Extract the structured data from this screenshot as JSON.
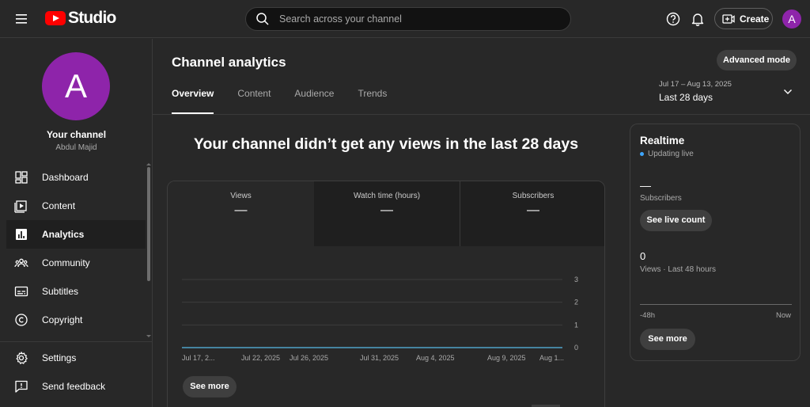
{
  "header": {
    "logo_text": "Studio",
    "search_placeholder": "Search across your channel",
    "create_label": "Create",
    "avatar_letter": "A",
    "icons": [
      "menu-icon",
      "youtube-logo-icon",
      "search-icon",
      "help-icon",
      "bell-icon",
      "create-video-icon"
    ]
  },
  "sidebar": {
    "avatar_letter": "A",
    "channel_label": "Your channel",
    "channel_owner": "Abdul Majid",
    "items": [
      {
        "label": "Dashboard",
        "icon": "dashboard-icon",
        "active": false
      },
      {
        "label": "Content",
        "icon": "content-icon",
        "active": false
      },
      {
        "label": "Analytics",
        "icon": "analytics-icon",
        "active": true
      },
      {
        "label": "Community",
        "icon": "community-icon",
        "active": false
      },
      {
        "label": "Subtitles",
        "icon": "subtitles-icon",
        "active": false
      },
      {
        "label": "Copyright",
        "icon": "copyright-icon",
        "active": false
      }
    ],
    "bottom_items": [
      {
        "label": "Settings",
        "icon": "settings-icon"
      },
      {
        "label": "Send feedback",
        "icon": "feedback-icon"
      }
    ]
  },
  "main": {
    "title": "Channel analytics",
    "advanced_mode_label": "Advanced mode",
    "tabs": [
      {
        "label": "Overview",
        "active": true
      },
      {
        "label": "Content",
        "active": false
      },
      {
        "label": "Audience",
        "active": false
      },
      {
        "label": "Trends",
        "active": false
      }
    ],
    "date_range": {
      "sub": "Jul 17 – Aug 13, 2025",
      "main": "Last 28 days"
    },
    "headline": "Your channel didn’t get any views in the last 28 days",
    "metrics": [
      {
        "label": "Views",
        "value": "—"
      },
      {
        "label": "Watch time (hours)",
        "value": "—"
      },
      {
        "label": "Subscribers",
        "value": "—"
      }
    ],
    "see_more_label": "See more"
  },
  "chart_data": {
    "type": "line",
    "x": [
      "Jul 17, 2...",
      "Jul 22, 2025",
      "Jul 26, 2025",
      "Jul 31, 2025",
      "Aug 4, 2025",
      "Aug 9, 2025",
      "Aug 1..."
    ],
    "series": [
      {
        "values": [
          0,
          0,
          0,
          0,
          0,
          0,
          0
        ]
      }
    ],
    "yticks": [
      0,
      1,
      2,
      3
    ],
    "ylim": [
      0,
      3
    ],
    "grid": true,
    "line_color": "#4fa3c7"
  },
  "realtime": {
    "title": "Realtime",
    "status": "Updating live",
    "subscribers_value": "—",
    "subscribers_label": "Subscribers",
    "live_count_label": "See live count",
    "views_value": "0",
    "views_label": "Views · Last 48 hours",
    "axis_left": "-48h",
    "axis_right": "Now",
    "see_more_label": "See more",
    "status_color": "#3ea6ff"
  },
  "colors": {
    "avatar": "#8e24aa",
    "brand": "#ff0000",
    "background": "#282828"
  }
}
